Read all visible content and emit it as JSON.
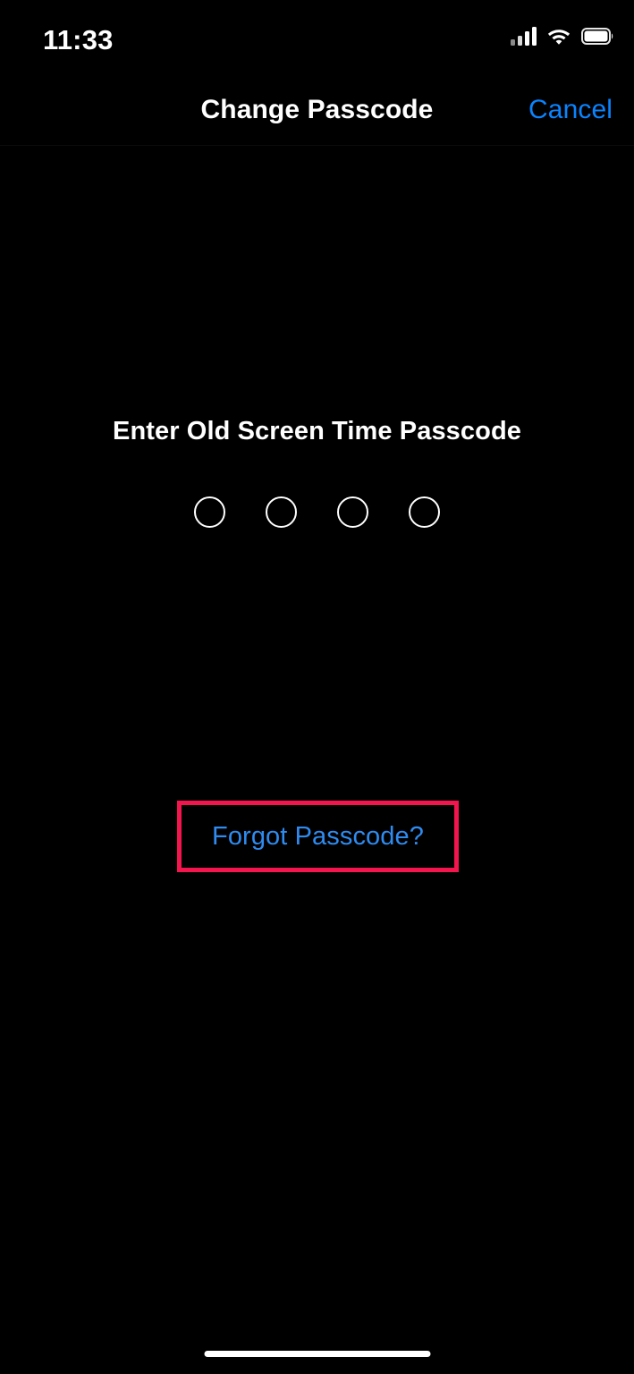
{
  "status_bar": {
    "time": "11:33",
    "cellular_icon": "cellular-signal-icon",
    "cellular_bars_total": 4,
    "cellular_bars_filled": 3,
    "wifi_icon": "wifi-icon",
    "battery_icon": "battery-full-icon",
    "battery_level": "100"
  },
  "nav_bar": {
    "title": "Change Passcode",
    "cancel_label": "Cancel"
  },
  "content": {
    "prompt": "Enter Old Screen Time Passcode",
    "passcode_length": 4,
    "passcode_entered": 0,
    "forgot_label": "Forgot Passcode?"
  },
  "colors": {
    "background": "#000000",
    "accent_blue": "#0a84ff",
    "link_blue": "#2f8bf0",
    "highlight_pink": "#f2154e",
    "text_primary": "#ffffff"
  },
  "home_indicator": {
    "name": "home-indicator"
  }
}
